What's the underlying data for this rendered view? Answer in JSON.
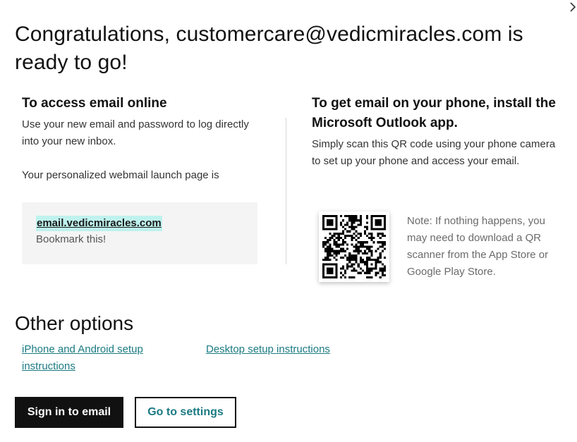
{
  "dialog": {
    "close_icon": "chevron-right-icon",
    "title": "Congratulations, customercare@vedicmiracles.com is ready to go!"
  },
  "online": {
    "heading": "To access email online",
    "description": "Use your new email and password to log directly into your new inbox.",
    "launch_text": "Your personalized webmail launch page is",
    "link": "email.vedicmiracles.com",
    "bookmark": "Bookmark this!"
  },
  "phone": {
    "heading": "To get email on your phone, install the Microsoft Outlook app.",
    "description": "Simply scan this QR code using your phone camera to set up your phone and access your email.",
    "note": "Note: If nothing happens, you may need to download a QR scanner from the App Store or Google Play Store."
  },
  "other": {
    "heading": "Other options",
    "mobile_link": "iPhone and Android setup instructions",
    "desktop_link": "Desktop setup instructions"
  },
  "actions": {
    "primary": "Sign in to email",
    "secondary": "Go to settings"
  },
  "colors": {
    "accent": "#1b7a82",
    "highlight": "#bff2ee",
    "primary_button": "#111111"
  }
}
